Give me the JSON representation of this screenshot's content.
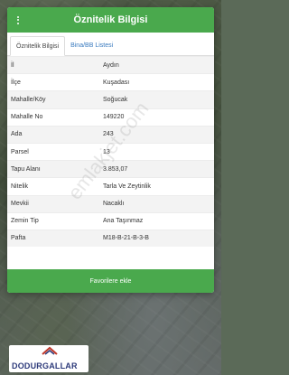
{
  "modal": {
    "title": "Öznitelik Bilgisi",
    "tabs": [
      {
        "label": "Öznitelik Bilgisi",
        "active": true
      },
      {
        "label": "Bina/BB Listesi",
        "active": false
      }
    ],
    "rows": [
      {
        "key": "İl",
        "value": "Aydın"
      },
      {
        "key": "İlçe",
        "value": "Kuşadası"
      },
      {
        "key": "Mahalle/Köy",
        "value": "Soğucak"
      },
      {
        "key": "Mahalle No",
        "value": "149220"
      },
      {
        "key": "Ada",
        "value": "243"
      },
      {
        "key": "Parsel",
        "value": "13"
      },
      {
        "key": "Tapu Alanı",
        "value": "3.853,07"
      },
      {
        "key": "Nitelik",
        "value": "Tarla Ve Zeytinlik"
      },
      {
        "key": "Mevkii",
        "value": "Nacaklı"
      },
      {
        "key": "Zemin Tip",
        "value": "Ana Taşınmaz"
      },
      {
        "key": "Pafta",
        "value": "M18-B-21-B-3-B"
      }
    ],
    "favorite_button": "Favorilere ekle"
  },
  "watermark": "emlakjet.com",
  "logo": {
    "text": "DODURGALLAR"
  },
  "colors": {
    "header": "#4aa94d",
    "link": "#3a7bbf",
    "logo_text": "#2d3a7a"
  }
}
